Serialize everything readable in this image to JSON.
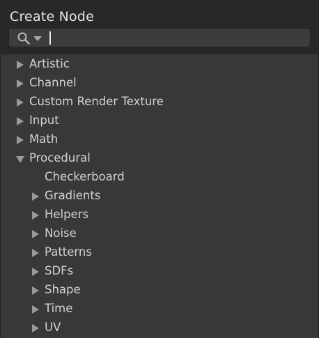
{
  "window": {
    "title": "Create Node"
  },
  "search": {
    "icon": "search-icon",
    "dropdown_icon": "chevron-down-icon",
    "value": ""
  },
  "colors": {
    "header_bg": "#282828",
    "panel_bg": "#383838",
    "text": "#d2d2d2",
    "arrow": "#9a9a9a"
  },
  "tree": {
    "items": [
      {
        "label": "Artistic",
        "expanded": false,
        "has_children": true,
        "depth": 0
      },
      {
        "label": "Channel",
        "expanded": false,
        "has_children": true,
        "depth": 0
      },
      {
        "label": "Custom Render Texture",
        "expanded": false,
        "has_children": true,
        "depth": 0
      },
      {
        "label": "Input",
        "expanded": false,
        "has_children": true,
        "depth": 0
      },
      {
        "label": "Math",
        "expanded": false,
        "has_children": true,
        "depth": 0
      },
      {
        "label": "Procedural",
        "expanded": true,
        "has_children": true,
        "depth": 0
      },
      {
        "label": "Checkerboard",
        "expanded": false,
        "has_children": false,
        "depth": 1
      },
      {
        "label": "Gradients",
        "expanded": false,
        "has_children": true,
        "depth": 1
      },
      {
        "label": "Helpers",
        "expanded": false,
        "has_children": true,
        "depth": 1
      },
      {
        "label": "Noise",
        "expanded": false,
        "has_children": true,
        "depth": 1
      },
      {
        "label": "Patterns",
        "expanded": false,
        "has_children": true,
        "depth": 1
      },
      {
        "label": "SDFs",
        "expanded": false,
        "has_children": true,
        "depth": 1
      },
      {
        "label": "Shape",
        "expanded": false,
        "has_children": true,
        "depth": 1
      },
      {
        "label": "Time",
        "expanded": false,
        "has_children": true,
        "depth": 1
      },
      {
        "label": "UV",
        "expanded": false,
        "has_children": true,
        "depth": 1
      }
    ]
  }
}
